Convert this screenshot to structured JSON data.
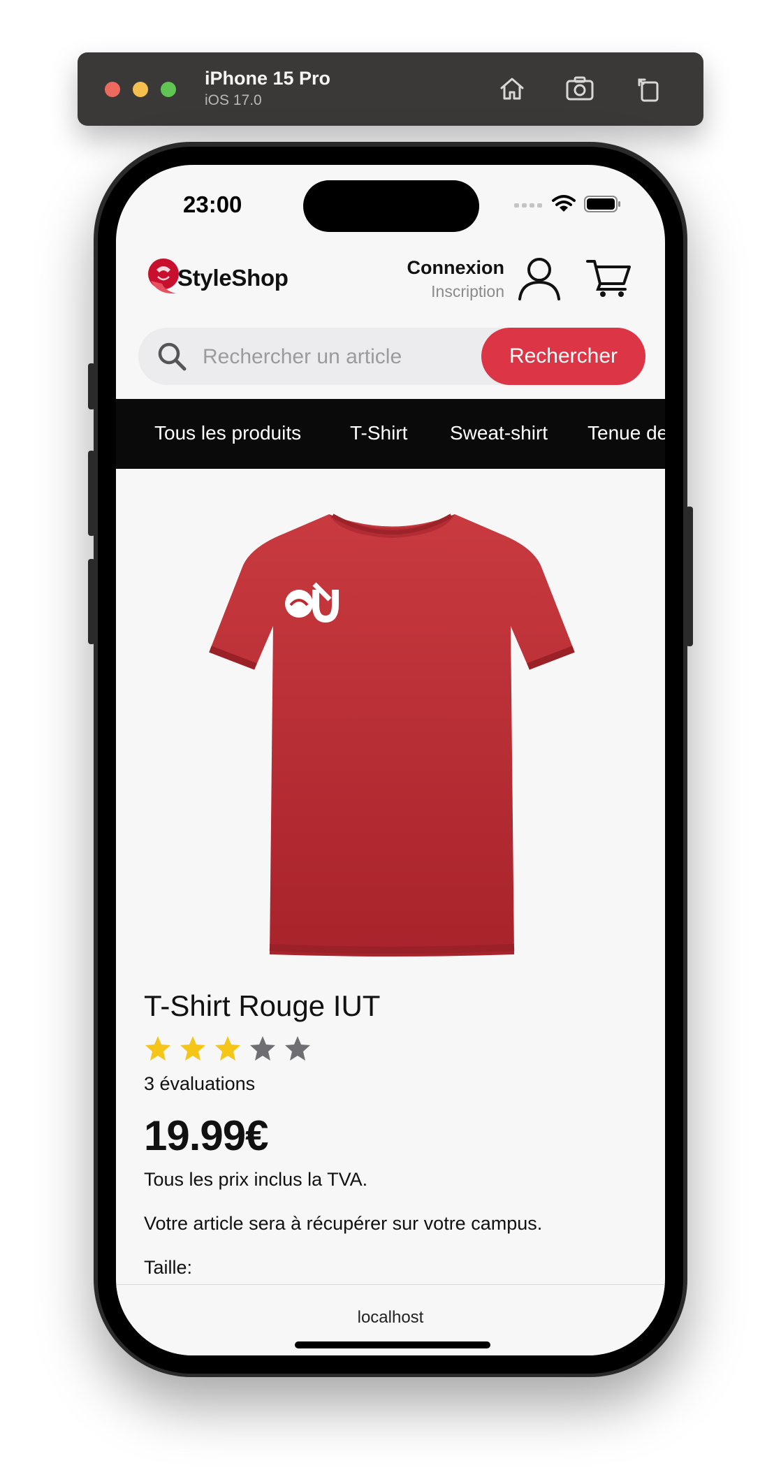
{
  "simulator": {
    "device_name": "iPhone 15 Pro",
    "os_version": "iOS 17.0",
    "traffic_lights": [
      "#ed6a5e",
      "#f5bf4f",
      "#61c554"
    ],
    "tools": [
      "home-icon",
      "screenshot-icon",
      "rotate-icon"
    ]
  },
  "status_bar": {
    "time": "23:00",
    "icons": [
      "cellular-icon",
      "wifi-icon",
      "battery-icon"
    ]
  },
  "header": {
    "brand": "StyleShop",
    "login": "Connexion",
    "signup": "Inscription",
    "brand_color": "#c8102e"
  },
  "search": {
    "placeholder": "Rechercher un article",
    "value": "",
    "button_label": "Rechercher",
    "button_color": "#dc3545"
  },
  "categories": [
    "Tous les produits",
    "T-Shirt",
    "Sweat-shirt",
    "Tenue de s"
  ],
  "product": {
    "title": "T-Shirt Rouge IUT",
    "rating": 3,
    "rating_max": 5,
    "reviews_count_text": "3 évaluations",
    "price": "19.99€",
    "tax_note": "Tous les prix inclus la TVA.",
    "pickup_note": "Votre article sera à récupérer sur votre campus.",
    "size_label": "Taille:",
    "color": "#c0282f",
    "star_color_on": "#f5c518",
    "star_color_off": "#6e6e73"
  },
  "browser": {
    "url": "localhost"
  }
}
